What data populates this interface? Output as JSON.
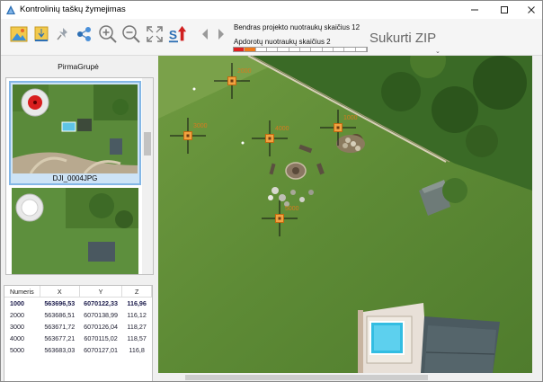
{
  "window": {
    "title": "Kontrolinių taškų žymejimas"
  },
  "toolbar": {
    "total_label": "Bendras projekto nuotraukų skaičius 12",
    "processed_label": "Apdorotų nuotraukų skaičius 2",
    "zip_label": "Sukurti ZIP",
    "progress": {
      "filled_segments": 2,
      "segments": 12,
      "colors": [
        "#e02020",
        "#f07818"
      ]
    },
    "icons": [
      "image-icon",
      "download-image-icon",
      "pin-icon",
      "share-nodes-icon",
      "zoom-in-icon",
      "zoom-out-icon",
      "fit-screen-icon",
      "sort-icon",
      "arrow-left-icon",
      "arrow-right-icon"
    ]
  },
  "left_panel": {
    "group_label": "PirmaGrupė",
    "thumbnails": [
      {
        "label": "DJI_0004JPG",
        "selected": true
      },
      {
        "label": "",
        "selected": false
      }
    ]
  },
  "table": {
    "headers": [
      "Numeris",
      "X",
      "Y",
      "Z"
    ],
    "rows": [
      [
        "1000",
        "563696,53",
        "6070122,33",
        "116,96"
      ],
      [
        "2000",
        "563686,51",
        "6070138,99",
        "116,12"
      ],
      [
        "3000",
        "563671,72",
        "6070126,04",
        "118,27"
      ],
      [
        "4000",
        "563677,21",
        "6070115,02",
        "118,57"
      ],
      [
        "5000",
        "563683,03",
        "6070127,01",
        "116,8"
      ]
    ]
  },
  "map": {
    "markers": [
      "2000",
      "3000",
      "4000",
      "1000",
      "5000"
    ]
  }
}
